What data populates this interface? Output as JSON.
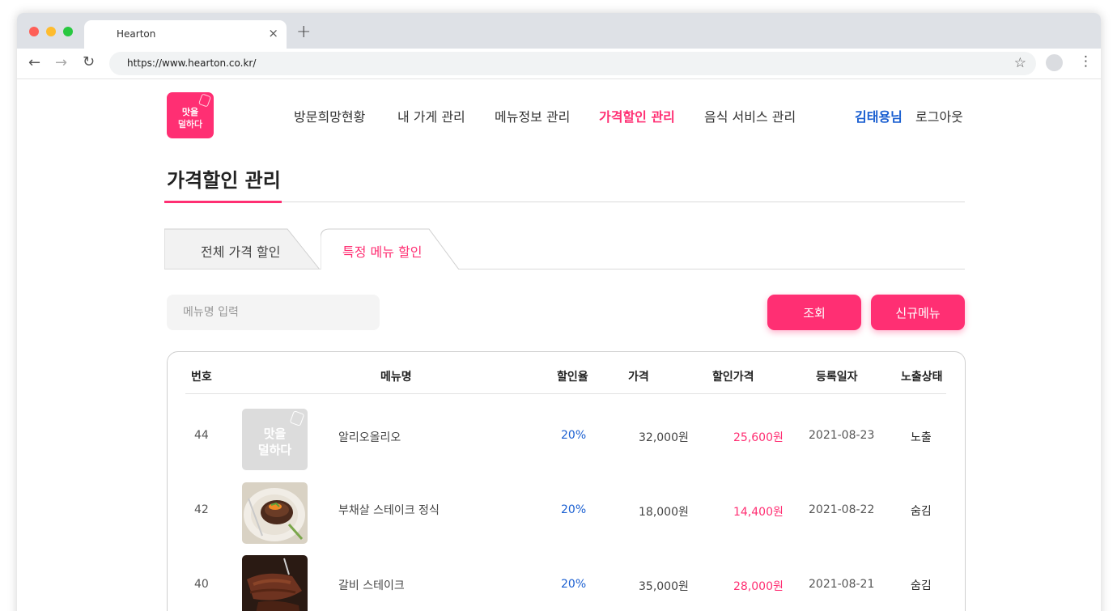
{
  "browser": {
    "tab_title": "Hearton",
    "tab_close": "×",
    "new_tab": "+",
    "url": "https://www.hearton.co.kr/",
    "back_icon": "←",
    "forward_icon": "→",
    "reload_icon": "↻",
    "star_icon": "☆",
    "menu_icon": "⋮"
  },
  "logo": {
    "line1": "맛을",
    "line2": "덜하다"
  },
  "nav": {
    "items": [
      {
        "label": "방문희망현황",
        "active": false
      },
      {
        "label": "내 가게 관리",
        "active": false
      },
      {
        "label": "메뉴정보 관리",
        "active": false
      },
      {
        "label": "가격할인 관리",
        "active": true
      },
      {
        "label": "음식 서비스 관리",
        "active": false
      }
    ],
    "user": "김태용님",
    "logout": "로그아웃"
  },
  "colors": {
    "accent": "#ff2f73",
    "blue": "#1a5fd1"
  },
  "page_title": "가격할인 관리",
  "subtabs": [
    {
      "label": "전체 가격 할인",
      "active": false
    },
    {
      "label": "특정 메뉴 할인",
      "active": true
    }
  ],
  "search": {
    "placeholder": "메뉴명 입력",
    "value": ""
  },
  "buttons": {
    "search": "조회",
    "new_menu": "신규메뉴"
  },
  "table": {
    "headers": [
      "번호",
      "메뉴명",
      "할인율",
      "가격",
      "할인가격",
      "등록일자",
      "노출상태"
    ],
    "rows": [
      {
        "no": "44",
        "image": "placeholder-logo",
        "name": "알리오올리오",
        "rate": "20%",
        "price": "32,000원",
        "discount_price": "25,600원",
        "date": "2021-08-23",
        "status": "노출"
      },
      {
        "no": "42",
        "image": "steak-plate-photo",
        "name": "부채살 스테이크 정식",
        "rate": "20%",
        "price": "18,000원",
        "discount_price": "14,400원",
        "date": "2021-08-22",
        "status": "숨김"
      },
      {
        "no": "40",
        "image": "galbi-steak-photo",
        "name": "갈비 스테이크",
        "rate": "20%",
        "price": "35,000원",
        "discount_price": "28,000원",
        "date": "2021-08-21",
        "status": "숨김"
      }
    ]
  }
}
